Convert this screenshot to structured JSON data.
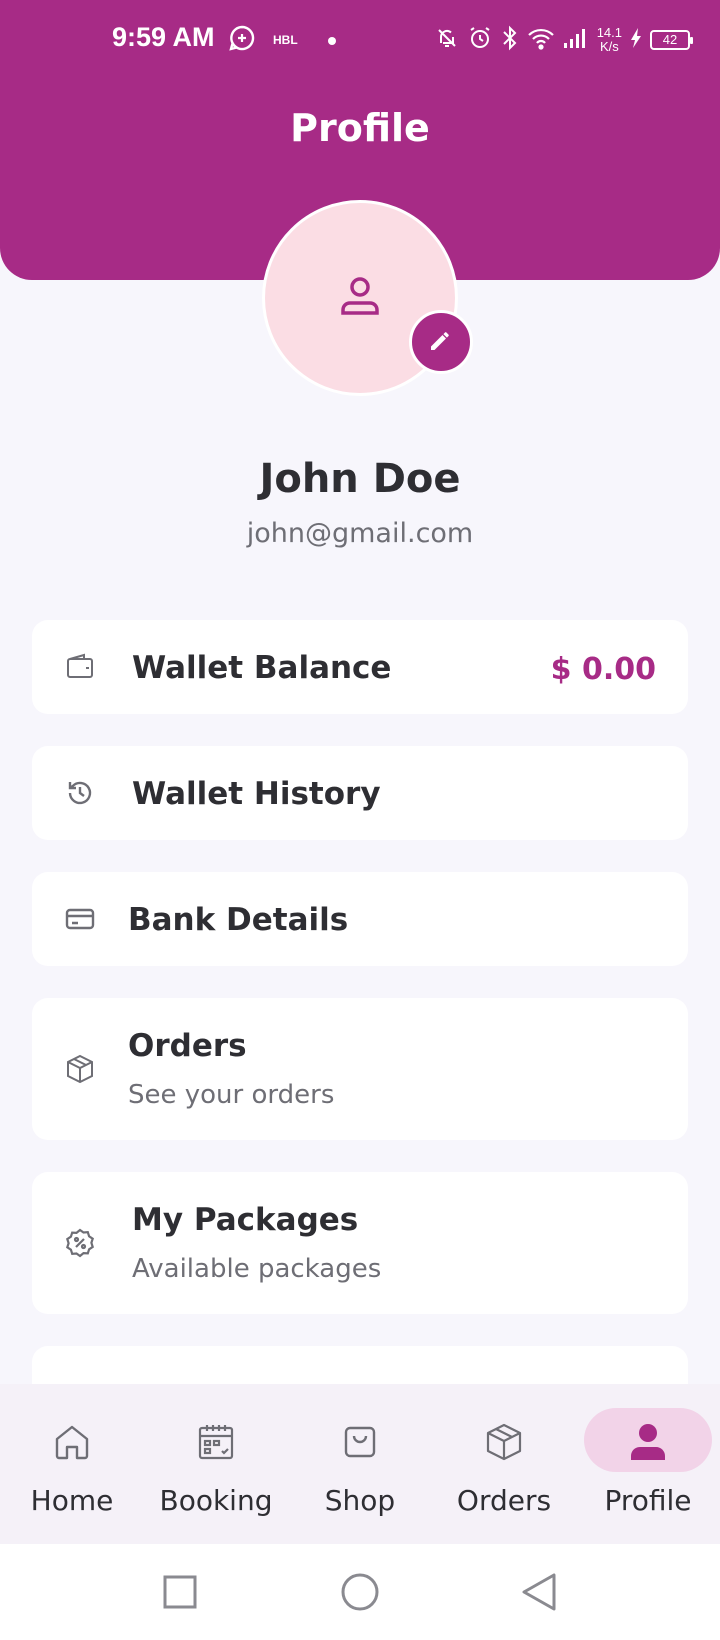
{
  "status_bar": {
    "time": "9:59 AM",
    "carrier_badge": "HBL",
    "net_speed_value": "14.1",
    "net_speed_unit": "K/s",
    "battery": "42"
  },
  "header": {
    "title": "Profile"
  },
  "profile": {
    "name": "John Doe",
    "email": "john@gmail.com"
  },
  "menu": {
    "wallet_balance": {
      "title": "Wallet Balance",
      "value": "$ 0.00"
    },
    "wallet_history": {
      "title": "Wallet History"
    },
    "bank_details": {
      "title": "Bank Details"
    },
    "orders": {
      "title": "Orders",
      "subtitle": "See your orders"
    },
    "my_packages": {
      "title": "My Packages",
      "subtitle": "Available packages"
    }
  },
  "bottom_nav": {
    "items": [
      {
        "label": "Home",
        "icon": "home-icon"
      },
      {
        "label": "Booking",
        "icon": "calendar-icon"
      },
      {
        "label": "Shop",
        "icon": "shopping-bag-icon"
      },
      {
        "label": "Orders",
        "icon": "box-icon"
      },
      {
        "label": "Profile",
        "icon": "person-icon",
        "active": true
      }
    ]
  },
  "colors": {
    "accent": "#a72b86",
    "avatar_bg": "#fbdde4",
    "page_bg": "#f7f6fc"
  }
}
